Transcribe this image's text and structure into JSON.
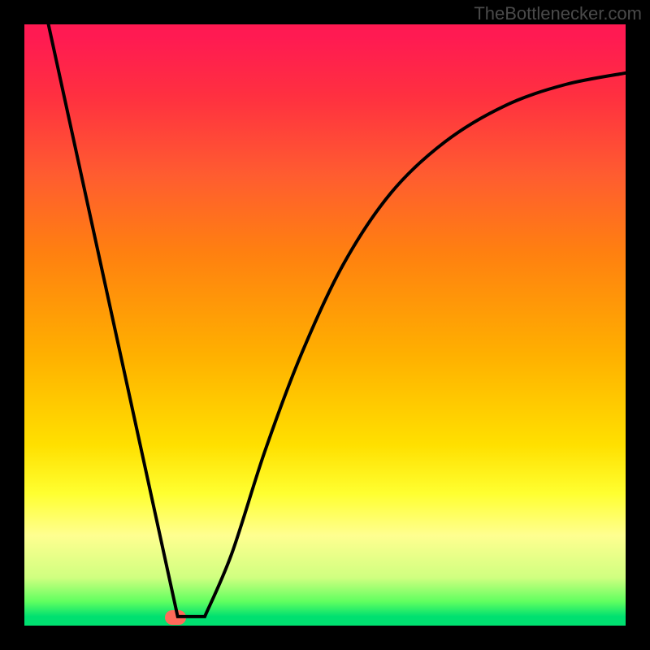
{
  "source_label": "TheBottlenecker.com",
  "chart_data": {
    "type": "line",
    "title": "",
    "xlabel": "",
    "ylabel": "",
    "xlim": [
      0,
      1
    ],
    "ylim": [
      0,
      1
    ],
    "series": [
      {
        "name": "curve",
        "points": [
          {
            "x": 0.04,
            "y": 1.0
          },
          {
            "x": 0.255,
            "y": 0.015
          },
          {
            "x": 0.3,
            "y": 0.015
          },
          {
            "x": 0.345,
            "y": 0.12
          },
          {
            "x": 0.4,
            "y": 0.29
          },
          {
            "x": 0.46,
            "y": 0.45
          },
          {
            "x": 0.53,
            "y": 0.6
          },
          {
            "x": 0.61,
            "y": 0.72
          },
          {
            "x": 0.7,
            "y": 0.805
          },
          {
            "x": 0.8,
            "y": 0.865
          },
          {
            "x": 0.9,
            "y": 0.9
          },
          {
            "x": 1.005,
            "y": 0.92
          }
        ]
      }
    ],
    "marker": {
      "x": 0.252,
      "y": 0.013
    },
    "colors": {
      "background_top": "#ff1a52",
      "background_bottom": "#00e070",
      "curve": "#000000",
      "dot": "#ff6a5a",
      "frame": "#000000"
    }
  }
}
